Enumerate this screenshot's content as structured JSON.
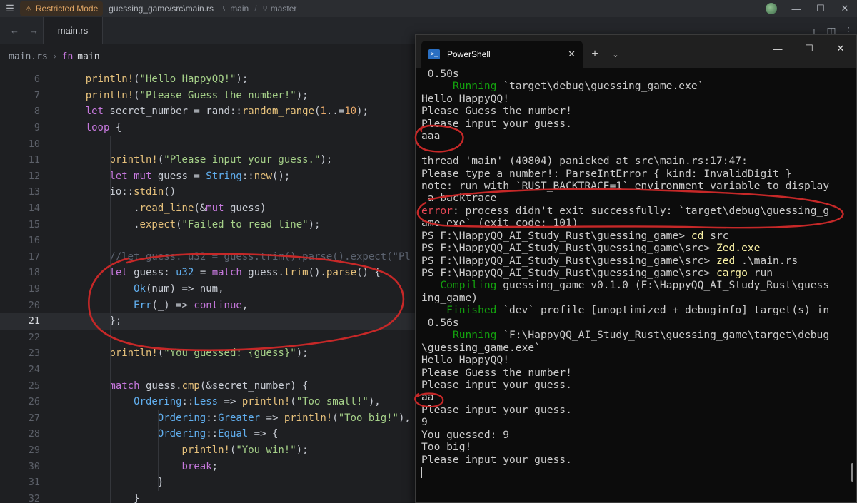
{
  "titlebar": {
    "restricted_label": "Restricted Mode",
    "project_path": "guessing_game/src\\main.rs",
    "branch_label": "main",
    "separator": "/",
    "git_branch": "master"
  },
  "tabs": [
    {
      "label": "main.rs"
    }
  ],
  "breadcrumb": {
    "file": "main.rs",
    "keyword": "fn",
    "symbol": "main"
  },
  "editor": {
    "active_line": 21,
    "lines": [
      {
        "n": "6",
        "code": "println!(\"Hello HappyQQ!\");"
      },
      {
        "n": "7",
        "code": "println!(\"Please Guess the number!\");"
      },
      {
        "n": "8",
        "code": "let secret_number = rand::random_range(1..=10);"
      },
      {
        "n": "9",
        "code": "loop {"
      },
      {
        "n": "10",
        "code": ""
      },
      {
        "n": "11",
        "code": "println!(\"Please input your guess.\");"
      },
      {
        "n": "12",
        "code": "let mut guess = String::new();"
      },
      {
        "n": "13",
        "code": "io::stdin()"
      },
      {
        "n": "14",
        "code": ".read_line(&mut guess)"
      },
      {
        "n": "15",
        "code": ".expect(\"Failed to read line\");"
      },
      {
        "n": "16",
        "code": ""
      },
      {
        "n": "17",
        "code": "//let guess: u32 = guess.trim().parse().expect(\"Pl"
      },
      {
        "n": "18",
        "code": "let guess: u32 = match guess.trim().parse() {"
      },
      {
        "n": "19",
        "code": "Ok(num) => num,"
      },
      {
        "n": "20",
        "code": "Err(_) => continue,"
      },
      {
        "n": "21",
        "code": "};"
      },
      {
        "n": "22",
        "code": ""
      },
      {
        "n": "23",
        "code": "println!(\"You guessed: {guess}\");"
      },
      {
        "n": "24",
        "code": ""
      },
      {
        "n": "25",
        "code": "match guess.cmp(&secret_number) {"
      },
      {
        "n": "26",
        "code": "Ordering::Less => println!(\"Too small!\"),"
      },
      {
        "n": "27",
        "code": "Ordering::Greater => println!(\"Too big!\"),"
      },
      {
        "n": "28",
        "code": "Ordering::Equal => {"
      },
      {
        "n": "29",
        "code": "println!(\"You win!\");"
      },
      {
        "n": "30",
        "code": "break;"
      },
      {
        "n": "31",
        "code": "}"
      },
      {
        "n": "32",
        "code": "}"
      }
    ]
  },
  "terminal": {
    "tab_title": "PowerShell",
    "lines": [
      " 0.50s",
      "     Running `target\\debug\\guessing_game.exe`",
      "Hello HappyQQ!",
      "Please Guess the number!",
      "Please input your guess.",
      "aaa",
      "",
      "thread 'main' (40804) panicked at src\\main.rs:17:47:",
      "Please type a number!: ParseIntError { kind: InvalidDigit }",
      "note: run with `RUST_BACKTRACE=1` environment variable to display",
      " a backtrace",
      "error: process didn't exit successfully: `target\\debug\\guessing_g",
      "ame.exe` (exit code: 101)",
      "PS F:\\HappyQQ_AI_Study_Rust\\guessing_game> cd src",
      "PS F:\\HappyQQ_AI_Study_Rust\\guessing_game\\src> Zed.exe",
      "PS F:\\HappyQQ_AI_Study_Rust\\guessing_game\\src> zed .\\main.rs",
      "PS F:\\HappyQQ_AI_Study_Rust\\guessing_game\\src> cargo run",
      "   Compiling guessing_game v0.1.0 (F:\\HappyQQ_AI_Study_Rust\\guess",
      "ing_game)",
      "    Finished `dev` profile [unoptimized + debuginfo] target(s) in",
      " 0.56s",
      "     Running `F:\\HappyQQ_AI_Study_Rust\\guessing_game\\target\\debug",
      "\\guessing_game.exe`",
      "Hello HappyQQ!",
      "Please Guess the number!",
      "Please input your guess.",
      "aa",
      "Please input your guess.",
      "9",
      "You guessed: 9",
      "Too big!",
      "Please input your guess."
    ]
  },
  "colors": {
    "annotation": "#c62828",
    "terminal_green": "#13a10e",
    "terminal_yellow": "#f9f1a5",
    "terminal_red": "#e74856"
  }
}
